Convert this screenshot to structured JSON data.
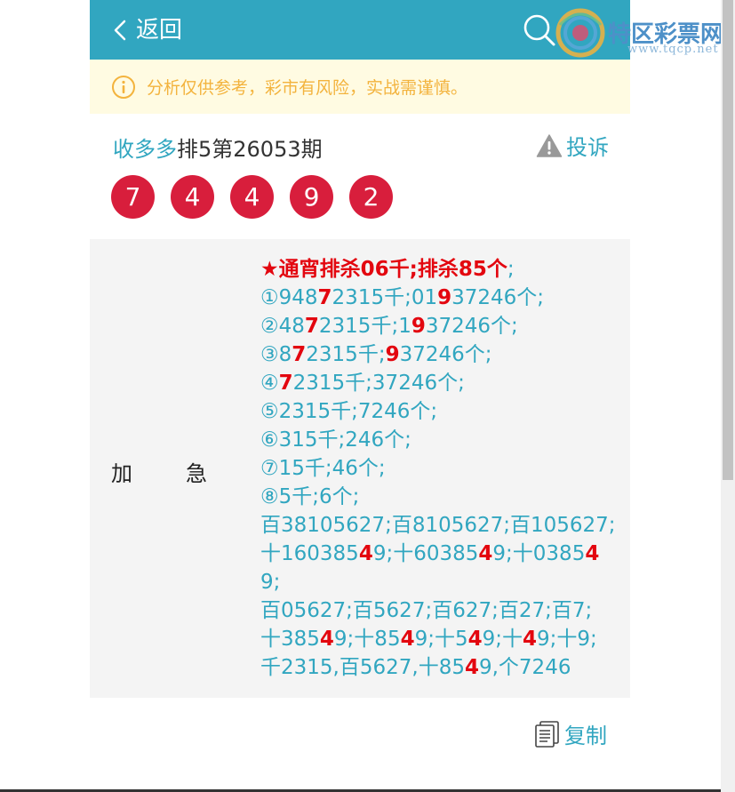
{
  "header": {
    "back_label": "返回",
    "back_icon": "chevron-left-icon",
    "search_icon": "search-icon"
  },
  "watermark": {
    "name": "特区彩票网",
    "url": "www.tqcp.net"
  },
  "notice": {
    "text": "分析仅供参考，彩市有风险，实战需谨慎。",
    "icon": "info-circle-icon"
  },
  "issue": {
    "author": "收多多",
    "name": "排5第26053期",
    "report_label": "投诉",
    "report_icon": "warning-icon"
  },
  "balls": [
    "7",
    "4",
    "4",
    "9",
    "2"
  ],
  "row": {
    "label_part1": "加",
    "label_part2": "急"
  },
  "prediction": {
    "lines": [
      [
        {
          "t": "★通宵排杀06千;排杀85个",
          "s": "hl"
        },
        {
          "t": ";",
          "s": ""
        }
      ],
      [
        {
          "t": "①948",
          "s": ""
        },
        {
          "t": "7",
          "s": "hl"
        },
        {
          "t": "2315千;01",
          "s": ""
        },
        {
          "t": "9",
          "s": "hl"
        },
        {
          "t": "37246个;",
          "s": ""
        }
      ],
      [
        {
          "t": "②48",
          "s": ""
        },
        {
          "t": "7",
          "s": "hl"
        },
        {
          "t": "2315千;1",
          "s": ""
        },
        {
          "t": "9",
          "s": "hl"
        },
        {
          "t": "37246个;",
          "s": ""
        }
      ],
      [
        {
          "t": "③8",
          "s": ""
        },
        {
          "t": "7",
          "s": "hl"
        },
        {
          "t": "2315千;",
          "s": ""
        },
        {
          "t": "9",
          "s": "hl"
        },
        {
          "t": "37246个;",
          "s": ""
        }
      ],
      [
        {
          "t": "④",
          "s": ""
        },
        {
          "t": "7",
          "s": "hl"
        },
        {
          "t": "2315千;37246个;",
          "s": ""
        }
      ],
      [
        {
          "t": "⑤2315千;7246个;",
          "s": ""
        }
      ],
      [
        {
          "t": "⑥315千;246个;",
          "s": ""
        }
      ],
      [
        {
          "t": "⑦15千;46个;",
          "s": ""
        }
      ],
      [
        {
          "t": "⑧5千;6个;",
          "s": ""
        }
      ],
      [
        {
          "t": "百38105627;百8105627;百105627;",
          "s": ""
        }
      ],
      [
        {
          "t": "十160385",
          "s": ""
        },
        {
          "t": "4",
          "s": "hl"
        },
        {
          "t": "9;十60385",
          "s": ""
        },
        {
          "t": "4",
          "s": "hl"
        },
        {
          "t": "9;十0385",
          "s": ""
        },
        {
          "t": "4",
          "s": "hl"
        }
      ],
      [
        {
          "t": "9;",
          "s": ""
        }
      ],
      [
        {
          "t": "百05627;百5627;百627;百27;百7;",
          "s": ""
        }
      ],
      [
        {
          "t": "十385",
          "s": ""
        },
        {
          "t": "4",
          "s": "hl"
        },
        {
          "t": "9;十85",
          "s": ""
        },
        {
          "t": "4",
          "s": "hl"
        },
        {
          "t": "9;十5",
          "s": ""
        },
        {
          "t": "4",
          "s": "hl"
        },
        {
          "t": "9;十",
          "s": ""
        },
        {
          "t": "4",
          "s": "hl"
        },
        {
          "t": "9;十9;",
          "s": ""
        }
      ],
      [
        {
          "t": "千2315,百5627,十85",
          "s": ""
        },
        {
          "t": "4",
          "s": "hl"
        },
        {
          "t": "9,个7246",
          "s": ""
        }
      ]
    ]
  },
  "copy": {
    "label": "复制",
    "icon": "copy-document-icon"
  },
  "colors": {
    "primary": "#31a6c0",
    "ball": "#d81e3c",
    "highlight": "#e3060f",
    "notice_bg": "#fffbe2",
    "notice_text": "#f3b33d"
  }
}
